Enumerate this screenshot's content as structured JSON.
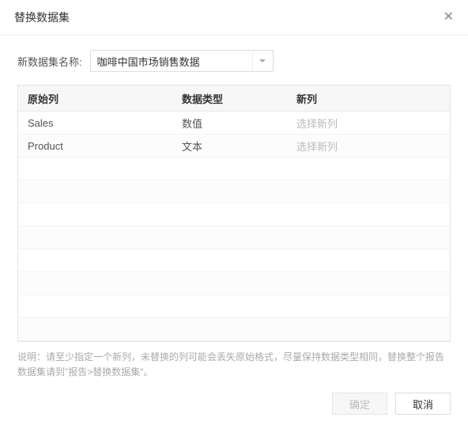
{
  "dialog": {
    "title": "替换数据集",
    "close_glyph": "✕"
  },
  "form": {
    "name_label": "新数据集名称:",
    "name_value": "咖啡中国市场销售数据"
  },
  "table": {
    "headers": {
      "original": "原始列",
      "datatype": "数据类型",
      "newcol": "新列"
    },
    "rows": [
      {
        "original": "Sales",
        "datatype": "数值",
        "newcol_placeholder": "选择新列"
      },
      {
        "original": "Product",
        "datatype": "文本",
        "newcol_placeholder": "选择新列"
      }
    ]
  },
  "hint": "说明：请至少指定一个新列，未替换的列可能会丢失原始格式，尽量保持数据类型相同，替换整个报告数据集请到\"报告>替换数据集\"。",
  "buttons": {
    "ok": "确定",
    "cancel": "取消"
  }
}
